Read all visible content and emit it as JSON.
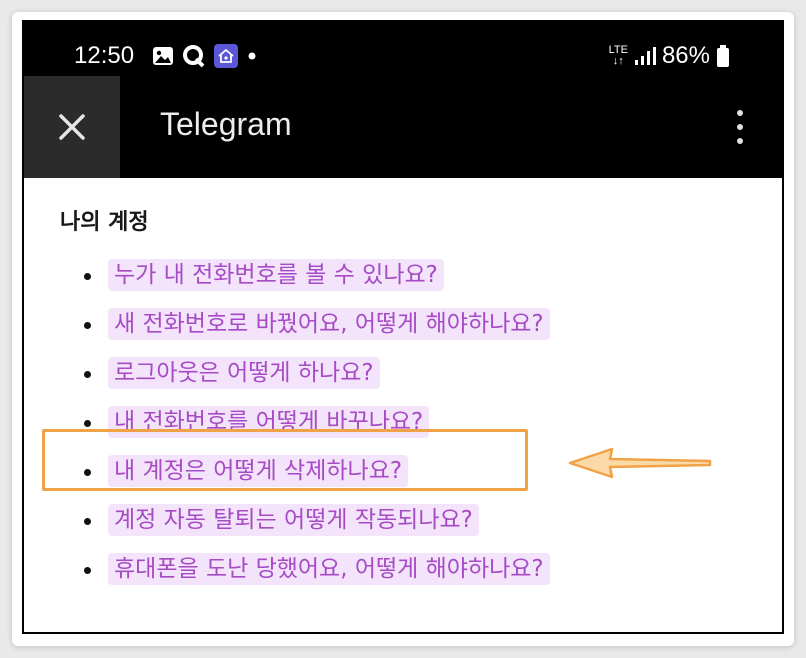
{
  "status_bar": {
    "time": "12:50",
    "network": "LTE",
    "battery": "86%"
  },
  "app_bar": {
    "title": "Telegram",
    "close_icon": "close-icon",
    "menu_icon": "more-vert-icon"
  },
  "section": {
    "title": "나의 계정",
    "items": [
      {
        "label": "누가 내 전화번호를 볼 수 있나요?"
      },
      {
        "label": "새 전화번호로 바꿨어요, 어떻게 해야하나요?"
      },
      {
        "label": "로그아웃은 어떻게 하나요?"
      },
      {
        "label": "내 전화번호를 어떻게 바꾸나요?"
      },
      {
        "label": "내 계정은 어떻게 삭제하나요?"
      },
      {
        "label": "계정 자동 탈퇴는 어떻게 작동되나요?"
      },
      {
        "label": "휴대폰을 도난 당했어요, 어떻게 해야하나요?"
      }
    ]
  },
  "annotation": {
    "highlight_color": "#f0a346",
    "highlighted_item_index": 4
  },
  "colors": {
    "link_text": "#a64bc4",
    "link_bg": "#f3e3fb",
    "app_bar_bg": "#000000"
  }
}
